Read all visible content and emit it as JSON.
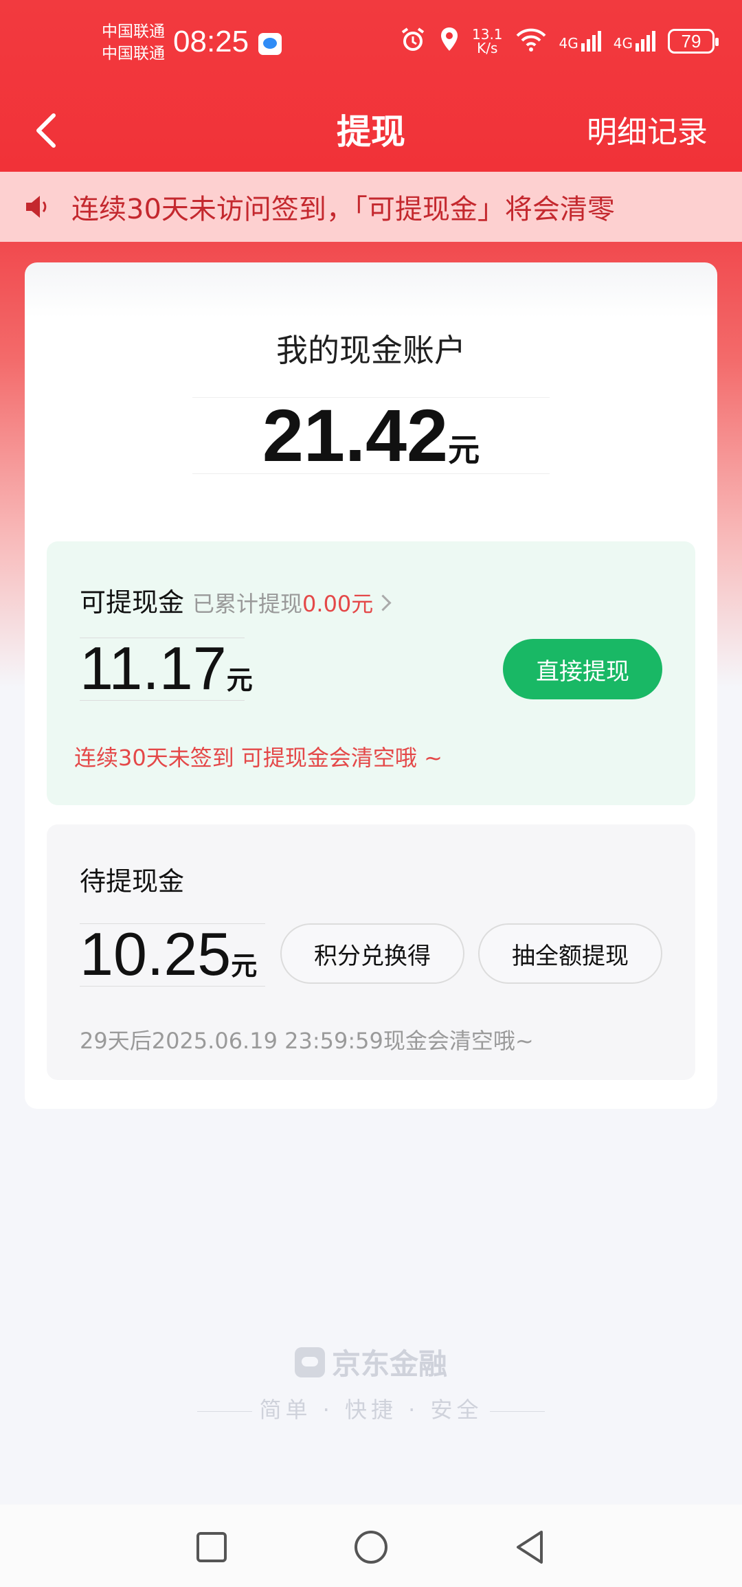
{
  "status_bar": {
    "carrier_1": "中国联通",
    "carrier_2": "中国联通",
    "time": "08:25",
    "net_speed_value": "13.1",
    "net_speed_unit": "K/s",
    "network_1": "4G",
    "network_2": "4G",
    "battery": "79"
  },
  "nav": {
    "title": "提现",
    "right_link": "明细记录"
  },
  "notice": {
    "text": "连续30天未访问签到，「可提现金」将会清零"
  },
  "account": {
    "title": "我的现金账户",
    "amount": "21.42",
    "unit": "元"
  },
  "withdrawable": {
    "title": "可提现金",
    "cumulative_label": "已累计提现",
    "cumulative_value": "0.00元",
    "amount": "11.17",
    "unit": "元",
    "button": "直接提现",
    "warning": "连续30天未签到 可提现金会清空哦 ~"
  },
  "pending": {
    "title": "待提现金",
    "amount": "10.25",
    "unit": "元",
    "button_exchange": "积分兑换得",
    "button_draw": "抽全额提现",
    "note": "29天后2025.06.19 23:59:59现金会清空哦~"
  },
  "brand": {
    "name": "京东金融",
    "slogan": "简单 · 快捷 · 安全"
  },
  "colors": {
    "header_red": "#f13238",
    "green_button": "#19b865",
    "warning_red": "#e44848"
  }
}
